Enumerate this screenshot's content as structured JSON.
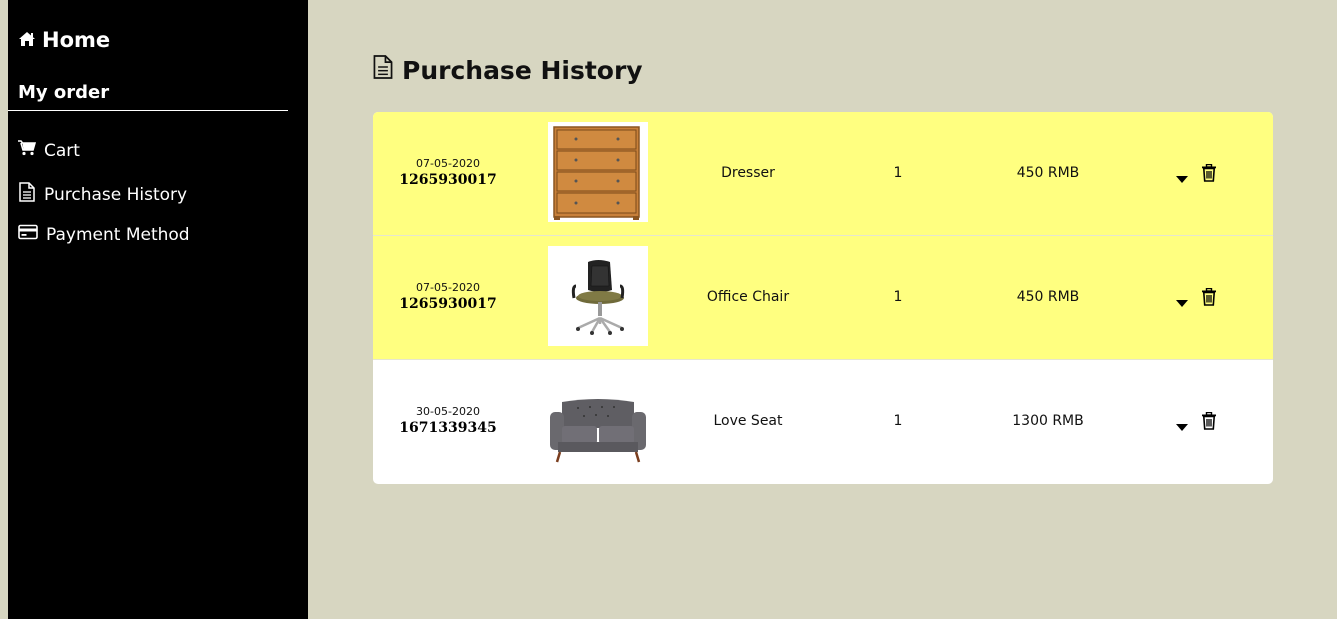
{
  "sidebar": {
    "home_label": "Home",
    "section_label": "My order",
    "items": [
      {
        "label": "Cart",
        "icon": "cart-icon"
      },
      {
        "label": "Purchase History",
        "icon": "document-icon"
      },
      {
        "label": "Payment Method",
        "icon": "credit-card-icon"
      }
    ]
  },
  "main": {
    "title": "Purchase History",
    "title_icon": "document-icon"
  },
  "orders": [
    {
      "date": "07-05-2020",
      "order_no": "1265930017",
      "product": "Dresser",
      "qty": "1",
      "price": "450 RMB",
      "image": "dresser-image",
      "highlighted": true
    },
    {
      "date": "07-05-2020",
      "order_no": "1265930017",
      "product": "Office Chair",
      "qty": "1",
      "price": "450 RMB",
      "image": "office-chair-image",
      "highlighted": true
    },
    {
      "date": "30-05-2020",
      "order_no": "1671339345",
      "product": "Love Seat",
      "qty": "1",
      "price": "1300 RMB",
      "image": "love-seat-image",
      "highlighted": false
    }
  ],
  "colors": {
    "background": "#d7d6c1",
    "sidebar": "#000000",
    "highlight_row": "#ffff80"
  }
}
